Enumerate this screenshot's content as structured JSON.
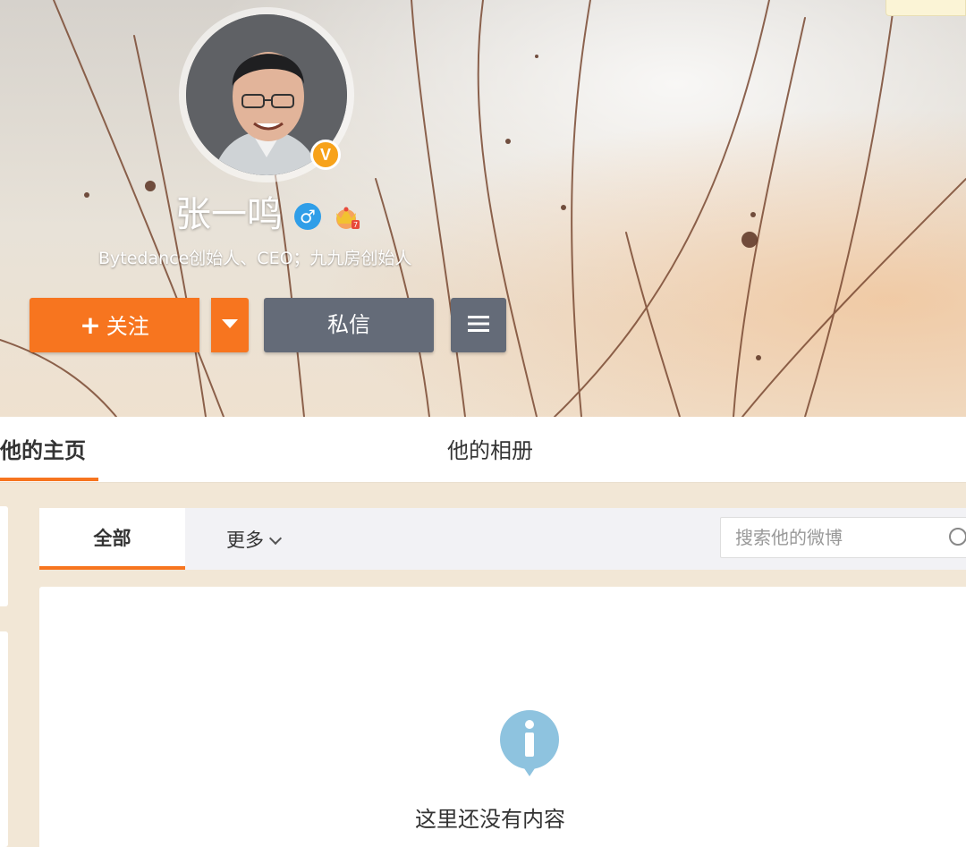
{
  "profile": {
    "name": "张一鸣",
    "bio": "Bytedance创始人、CEO；九九房创始人",
    "verified_badge": "V",
    "gender_symbol": "♂"
  },
  "actions": {
    "follow_plus": "+",
    "follow_label": "关注",
    "message_label": "私信"
  },
  "tabs": {
    "home": "他的主页",
    "album": "他的相册"
  },
  "feed": {
    "filter_all": "全部",
    "filter_more": "更多",
    "search_placeholder": "搜索他的微博",
    "empty_message": "这里还没有内容"
  },
  "colors": {
    "accent": "#f7751f",
    "secondary_button": "#646b78",
    "info_icon": "#8ec3df",
    "page_bg": "#f2e7d6"
  }
}
